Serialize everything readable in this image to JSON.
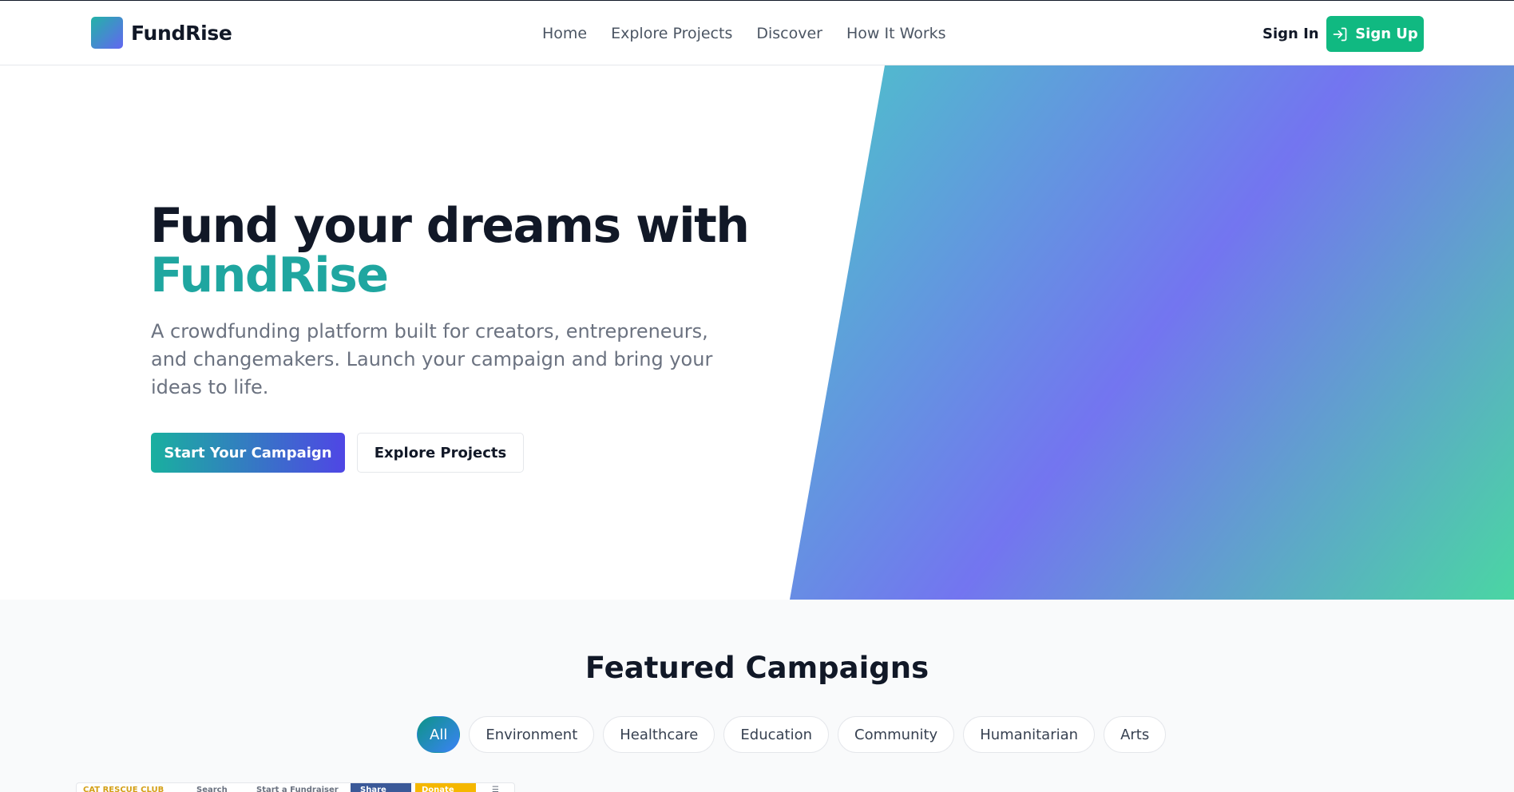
{
  "brand": {
    "name": "FundRise"
  },
  "nav": {
    "links": [
      "Home",
      "Explore Projects",
      "Discover",
      "How It Works"
    ],
    "sign_in": "Sign In",
    "sign_up": "Sign Up"
  },
  "hero": {
    "title_line1": "Fund your dreams with",
    "title_accent": "FundRise",
    "subtitle": "A crowdfunding platform built for creators, entrepreneurs, and changemakers. Launch your campaign and bring your ideas to life.",
    "primary_cta": "Start Your Campaign",
    "secondary_cta": "Explore Projects"
  },
  "featured": {
    "title": "Featured Campaigns",
    "filters": [
      "All",
      "Environment",
      "Healthcare",
      "Education",
      "Community",
      "Humanitarian",
      "Arts"
    ],
    "active_filter": "All"
  },
  "preview_strip": {
    "logo_text": "CAT RESCUE CLUB",
    "search": "Search",
    "start": "Start a Fundraiser",
    "share": "Share",
    "donate": "Donate"
  },
  "colors": {
    "accent_teal": "#1fa6a0",
    "signup_green": "#10b981",
    "gradient_teal": "#4cc4c9",
    "gradient_indigo": "#7375f0",
    "gradient_green": "#4ad6a3"
  }
}
